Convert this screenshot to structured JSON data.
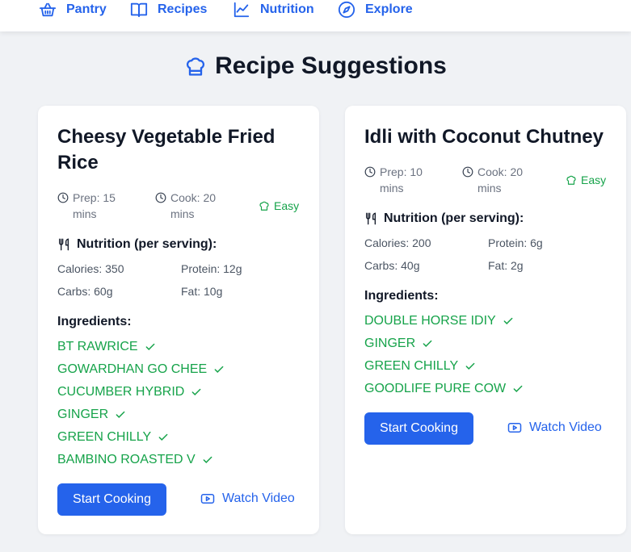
{
  "nav": {
    "items": [
      {
        "label": "Pantry",
        "icon": "basket-icon"
      },
      {
        "label": "Recipes",
        "icon": "book-icon"
      },
      {
        "label": "Nutrition",
        "icon": "chart-line-icon"
      },
      {
        "label": "Explore",
        "icon": "compass-icon"
      }
    ]
  },
  "page": {
    "title": "Recipe Suggestions",
    "title_icon": "chef-hat-icon"
  },
  "recipes": [
    {
      "title": "Cheesy Vegetable Fried Rice",
      "prep": "Prep: 15 mins",
      "cook": "Cook: 20 mins",
      "difficulty": "Easy",
      "nutrition_title": "Nutrition (per serving):",
      "calories": "Calories: 350",
      "protein": "Protein: 12g",
      "carbs": "Carbs: 60g",
      "fat": "Fat: 10g",
      "ingredients_title": "Ingredients:",
      "ingredients": [
        "BT RAWRICE",
        "GOWARDHAN GO CHEE",
        "CUCUMBER HYBRID",
        "GINGER",
        "GREEN CHILLY",
        "BAMBINO ROASTED V"
      ],
      "start_label": "Start Cooking",
      "video_label": "Watch Video"
    },
    {
      "title": "Idli with Coconut Chutney",
      "prep": "Prep: 10 mins",
      "cook": "Cook: 20 mins",
      "difficulty": "Easy",
      "nutrition_title": "Nutrition (per serving):",
      "calories": "Calories: 200",
      "protein": "Protein: 6g",
      "carbs": "Carbs: 40g",
      "fat": "Fat: 2g",
      "ingredients_title": "Ingredients:",
      "ingredients": [
        "DOUBLE HORSE IDIY",
        "GINGER",
        "GREEN CHILLY",
        "GOODLIFE PURE COW"
      ],
      "start_label": "Start Cooking",
      "video_label": "Watch Video"
    }
  ],
  "colors": {
    "accent": "#2563eb",
    "success": "#16a34a",
    "background": "#f0f2f5"
  }
}
